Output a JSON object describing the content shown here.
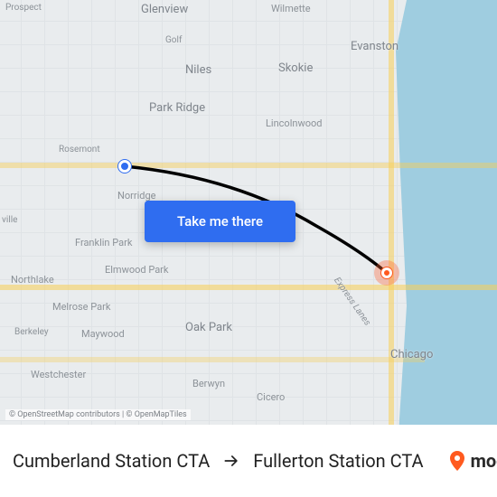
{
  "map": {
    "cta_label": "Take me there",
    "attribution": "© OpenStreetMap contributors  |  © OpenMapTiles",
    "express_lanes_label": "Express Lanes",
    "places": {
      "prospect": "Prospect",
      "glenview": "Glenview",
      "wilmette": "Wilmette",
      "golf": "Golf",
      "niles": "Niles",
      "skokie": "Skokie",
      "evanston": "Evanston",
      "park_ridge": "Park Ridge",
      "lincolnwood": "Lincolnwood",
      "rosemont": "Rosemont",
      "norridge": "Norridge",
      "ville": "ville",
      "franklin_park": "Franklin Park",
      "elmwood_park": "Elmwood Park",
      "northlake": "Northlake",
      "melrose_park": "Melrose Park",
      "berkeley": "Berkeley",
      "maywood": "Maywood",
      "oak_park": "Oak Park",
      "westchester": "Westchester",
      "berwyn": "Berwyn",
      "cicero": "Cicero",
      "chicago": "Chicago"
    }
  },
  "footer": {
    "from": "Cumberland Station CTA",
    "to": "Fullerton Station CTA",
    "brand": "moovit"
  }
}
